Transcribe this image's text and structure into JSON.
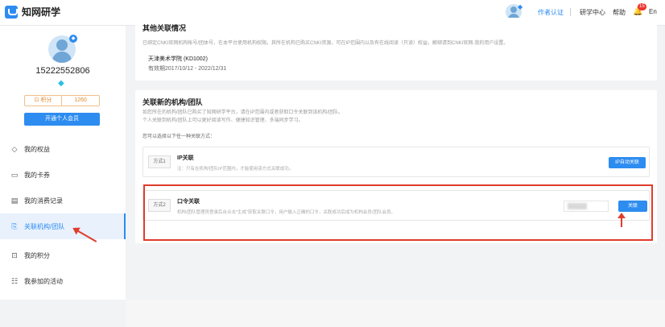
{
  "app": {
    "title": "知网研学"
  },
  "topbar": {
    "auth_link": "作者认证",
    "study_center": "研学中心",
    "help": "帮助",
    "notification_count": "15",
    "language": "En"
  },
  "profile": {
    "username": "15222552806",
    "points_label": "积分",
    "points_value": "1260",
    "vip_button": "开通个人会员"
  },
  "nav": {
    "items": [
      {
        "label": "我的权益",
        "icon": "diamond-icon"
      },
      {
        "label": "我的卡券",
        "icon": "ticket-icon"
      },
      {
        "label": "我的消费记录",
        "icon": "document-icon"
      },
      {
        "label": "关联机构/团队",
        "icon": "link-document-icon",
        "active": true
      },
      {
        "label": "我的积分",
        "icon": "points-icon"
      },
      {
        "label": "我参加的活动",
        "icon": "activity-icon"
      }
    ]
  },
  "other_assoc": {
    "title": "其他关联情况",
    "desc": "已绑定CNKI官网机构帐号/团体号，在本平台使用机构权限。其所在机构已购买CNKI资源，可在IP范围内以及有在线阅读（只读）权益。解绑请到CNKI官网-我的用户设置。",
    "institution": "天津美术学院 (KD1002)",
    "validity": "有效期2017/10/12 - 2022/12/31"
  },
  "new_assoc": {
    "title": "关联新的机构/团队",
    "line1": "如您所在的机构/团队已购买了知网研学平台，请在IP范围内或者获取口令关联到该机构/团队。",
    "line2": "个人关联到机构/团队上可以更好阅读写作、便捷知识管理、多端同步学习。",
    "choose": "您可以选择以下任一种关联方式："
  },
  "method1": {
    "tag": "方式1",
    "name": "IP关联",
    "desc": "注：只有在机构/团队IP范围内，才能使用该方式关联成功。",
    "button": "IP自动关联"
  },
  "method2": {
    "tag": "方式2",
    "name": "口令关联",
    "desc": "机构/团队管理员登录后台点击\"生成\"获取关联口令，用户输入正确的口令，关联成功后成为机构会员/团队会员。",
    "button": "关联"
  },
  "colors": {
    "accent": "#2d8cf0",
    "highlight": "#e03c2c"
  }
}
